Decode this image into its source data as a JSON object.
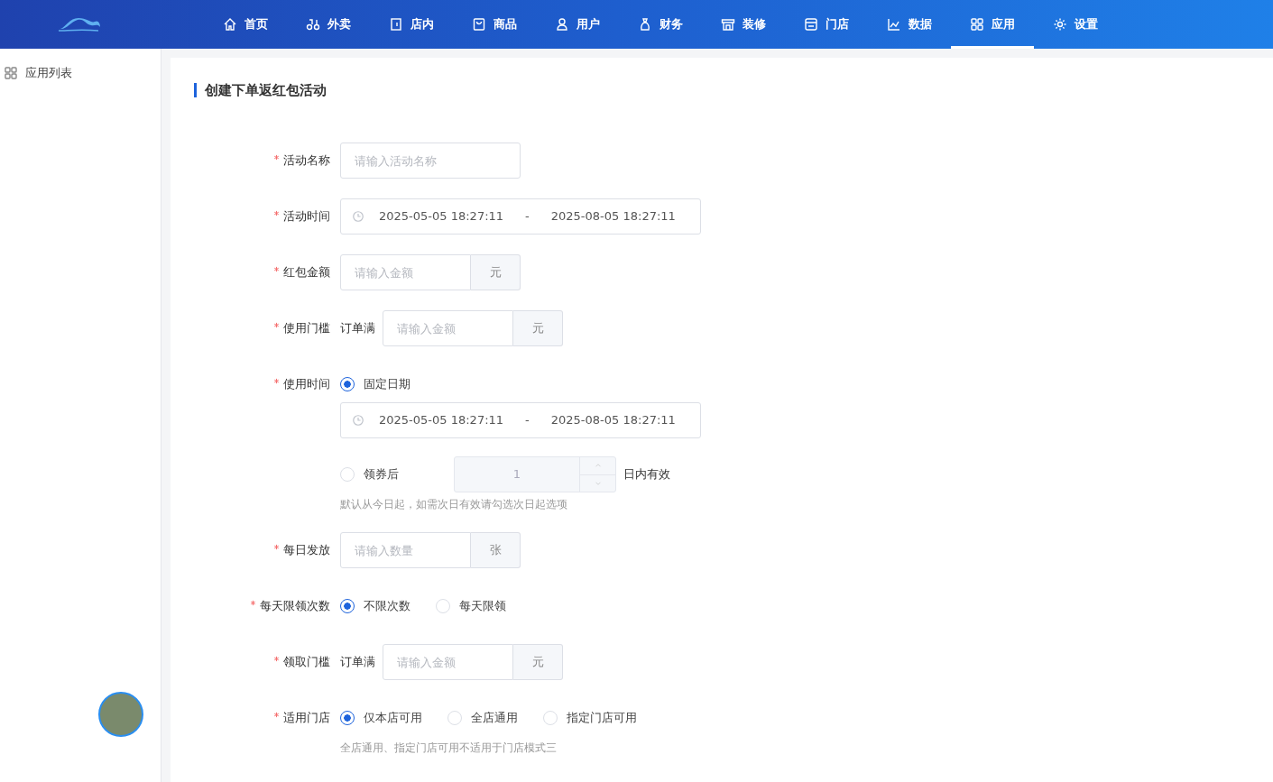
{
  "nav": {
    "items": [
      {
        "label": "首页",
        "selected": false
      },
      {
        "label": "外卖",
        "selected": false
      },
      {
        "label": "店内",
        "selected": false
      },
      {
        "label": "商品",
        "selected": false
      },
      {
        "label": "用户",
        "selected": false
      },
      {
        "label": "财务",
        "selected": false
      },
      {
        "label": "装修",
        "selected": false
      },
      {
        "label": "门店",
        "selected": false
      },
      {
        "label": "数据",
        "selected": false
      },
      {
        "label": "应用",
        "selected": true
      },
      {
        "label": "设置",
        "selected": false
      }
    ]
  },
  "sidebar": {
    "items": [
      {
        "label": "应用列表"
      }
    ]
  },
  "form": {
    "title": "创建下单返红包活动",
    "fields": [
      {
        "kind": "text",
        "label": "活动名称",
        "required": true,
        "placeholder": "请输入活动名称"
      },
      {
        "kind": "daterange",
        "label": "活动时间",
        "required": true,
        "start": "2025-05-05 18:27:11",
        "separator": "-",
        "end": "2025-08-05 18:27:11"
      },
      {
        "kind": "addon",
        "label": "红包金额",
        "required": true,
        "placeholder": "请输入金额",
        "suffix": "元"
      },
      {
        "kind": "addon",
        "label": "使用门槛",
        "required": true,
        "prefix": "订单满",
        "placeholder": "请输入金额",
        "suffix": "元"
      },
      {
        "kind": "usetime",
        "label": "使用时间",
        "required": true,
        "options": [
          {
            "kind": "daterange",
            "label": "固定日期",
            "selected": true,
            "start": "2025-05-05 18:27:11",
            "separator": "-",
            "end": "2025-08-05 18:27:11"
          },
          {
            "kind": "days",
            "label": "领券后",
            "selected": false,
            "value": "1",
            "suffix": "日内有效"
          }
        ],
        "hint": "默认从今日起，如需次日有效请勾选次日起选项"
      },
      {
        "kind": "addon",
        "label": "每日发放",
        "required": true,
        "placeholder": "请输入数量",
        "suffix": "张"
      },
      {
        "kind": "radio",
        "label": "每天限领次数",
        "required": true,
        "options": [
          {
            "label": "不限次数",
            "selected": true
          },
          {
            "label": "每天限领",
            "selected": false
          }
        ]
      },
      {
        "kind": "addon",
        "label": "领取门槛",
        "required": true,
        "prefix": "订单满",
        "placeholder": "请输入金额",
        "suffix": "元"
      },
      {
        "kind": "radio",
        "label": "适用门店",
        "required": true,
        "options": [
          {
            "label": "仅本店可用",
            "selected": true
          },
          {
            "label": "全店通用",
            "selected": false
          },
          {
            "label": "指定门店可用",
            "selected": false
          }
        ],
        "hint": "全店通用、指定门店可用不适用于门店模式三"
      }
    ]
  }
}
